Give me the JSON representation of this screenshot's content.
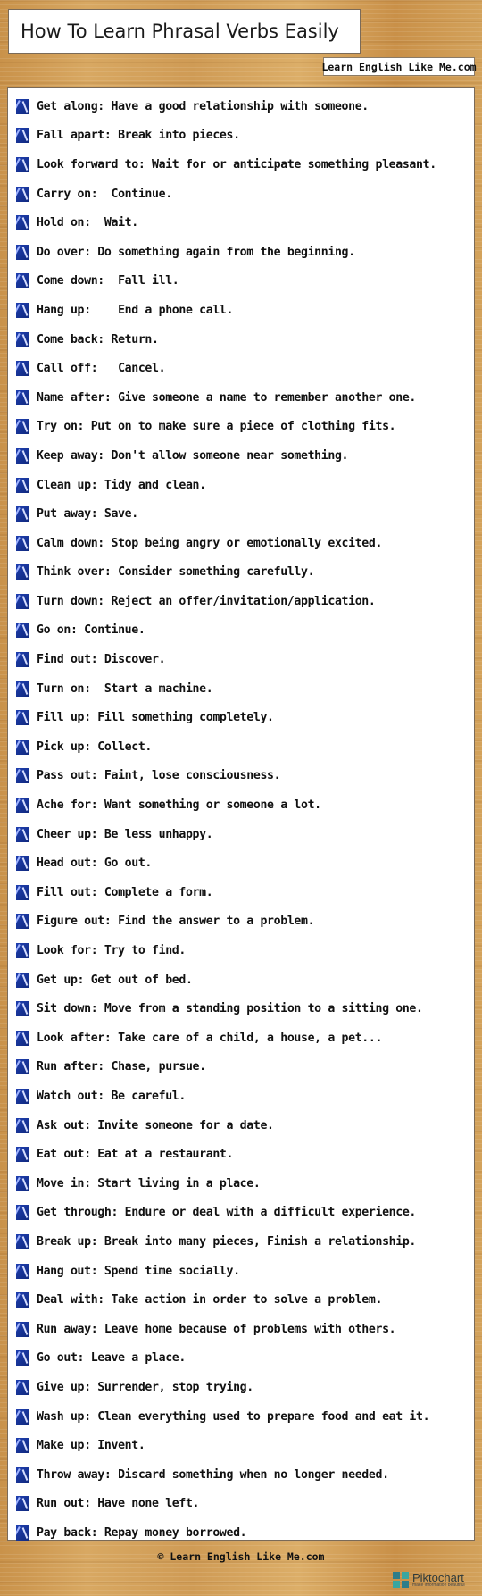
{
  "header": {
    "title": "How To Learn Phrasal Verbs Easily",
    "brand": "Learn English Like Me.com"
  },
  "icon": "book-icon",
  "items": [
    "Get along: Have a good relationship with someone.",
    "Fall apart: Break into pieces.",
    "Look forward to: Wait for or anticipate something pleasant.",
    "Carry on:  Continue.",
    "Hold on:  Wait.",
    "Do over: Do something again from the beginning.",
    "Come down:  Fall ill.",
    "Hang up:    End a phone call.",
    "Come back: Return.",
    "Call off:   Cancel.",
    "Name after: Give someone a name to remember another one.",
    "Try on: Put on to make sure a piece of clothing fits.",
    "Keep away: Don't allow someone near something.",
    "Clean up: Tidy and clean.",
    "Put away: Save.",
    "Calm down: Stop being angry or emotionally excited.",
    "Think over: Consider something carefully.",
    "Turn down: Reject an offer/invitation/application.",
    "Go on: Continue.",
    "Find out: Discover.",
    "Turn on:  Start a machine.",
    "Fill up: Fill something completely.",
    "Pick up: Collect.",
    "Pass out: Faint, lose consciousness.",
    "Ache for: Want something or someone a lot.",
    "Cheer up: Be less unhappy.",
    "Head out: Go out.",
    "Fill out: Complete a form.",
    "Figure out: Find the answer to a problem.",
    "Look for: Try to find.",
    "Get up: Get out of bed.",
    "Sit down: Move from a standing position to a sitting one.",
    "Look after: Take care of a child, a house, a pet...",
    "Run after: Chase, pursue.",
    "Watch out: Be careful.",
    "Ask out: Invite someone for a date.",
    "Eat out: Eat at a restaurant.",
    "Move in: Start living in a place.",
    "Get through: Endure or deal with a difficult experience.",
    "Break up: Break into many pieces, Finish a relationship.",
    "Hang out: Spend time socially.",
    "Deal with: Take action in order to solve a problem.",
    "Run away: Leave home because of problems with others.",
    "Go out: Leave a place.",
    "Give up: Surrender, stop trying.",
    "Wash up: Clean everything used to prepare food and eat it.",
    "Make up: Invent.",
    "Throw away: Discard something when no longer needed.",
    "Run out: Have none left.",
    "Pay back: Repay money borrowed."
  ],
  "footer": {
    "copyright": "© Learn English Like Me.com",
    "piktochart_name": "Piktochart",
    "piktochart_tagline": "make information beautiful"
  },
  "colors": {
    "wood": "#d3a25b",
    "panel": "#ffffff",
    "icon_blue": "#1f3fb0"
  }
}
